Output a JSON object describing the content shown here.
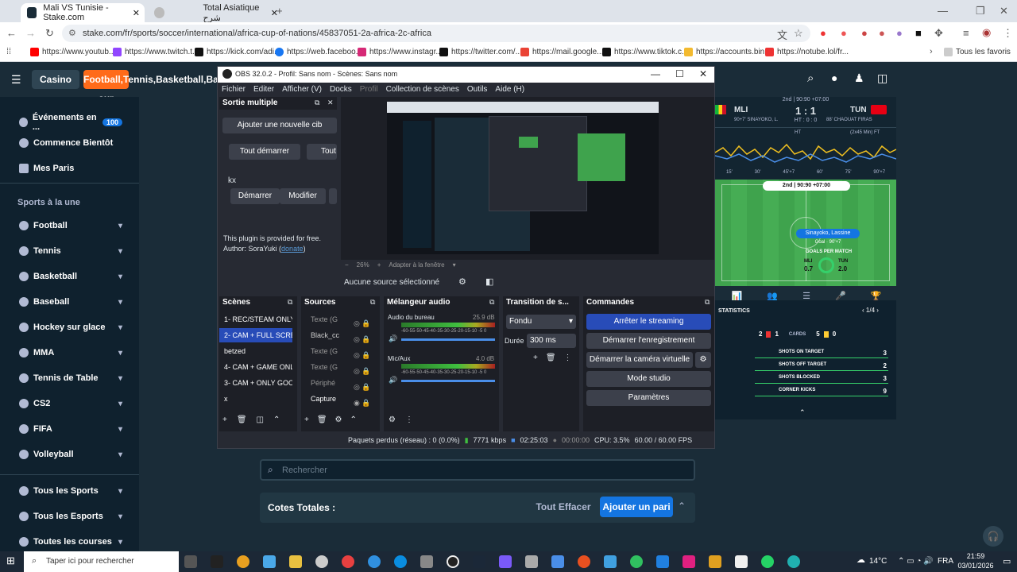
{
  "browser": {
    "tabs": [
      {
        "title": "Mali VS Tunisie - Stake.com"
      },
      {
        "title": "Total Asiatique شرح"
      }
    ],
    "url": "stake.com/fr/sports/soccer/international/africa-cup-of-nations/45837051-2a-africa-2c-africa",
    "bookmarks": [
      "https://www.youtub...",
      "https://www.twitch.t...",
      "https://kick.com/adi...",
      "https://web.faceboo...",
      "https://www.instagr...",
      "https://twitter.com/...",
      "https://mail.google...",
      "https://www.tiktok.c...",
      "https://accounts.bin...",
      "https://notube.lol/fr..."
    ],
    "all_bookmarks": "Tous les favoris"
  },
  "site": {
    "casino": "Casino",
    "sports": [
      "Football",
      "Tennis",
      "Basketball",
      "Baseball",
      "Hockey sur glace",
      "MMA",
      "Tennis de Table",
      "CS2",
      "FIFA",
      "Volleyball"
    ],
    "nav": [
      {
        "label": "Événements en ...",
        "badge": "100"
      },
      {
        "label": "Commence Bientôt"
      },
      {
        "label": "Mes Paris"
      }
    ],
    "section_title": "Sports à la une",
    "bottom": [
      "Tous les Sports",
      "Tous les Esports",
      "Toutes les courses"
    ],
    "search_placeholder": "Rechercher",
    "betslip": {
      "title": "Cotes Totales :",
      "clear": "Tout Effacer",
      "add": "Ajouter un pari"
    }
  },
  "match": {
    "period": "2nd | 90:90 +07:00",
    "team_home": "MLI",
    "team_away": "TUN",
    "score": "1 : 1",
    "ht": "HT : 0 : 0",
    "event_home": "90+7' SINAYOKO, L.",
    "event_away": "88' CHAOUAT FIRAS",
    "ft": "(2x45 Min) FT",
    "ht_marker": "HT",
    "timeline": [
      "15'",
      "30'",
      "45'+7",
      "60'",
      "75'",
      "90'+7"
    ],
    "pitch_time": "2nd | 90:90 +07:00",
    "player": "Sinayoko, Lassine",
    "goal": "Goal · 90'+7",
    "goals_per_match": "GOALS PER MATCH",
    "gpm_home": "0.7",
    "gpm_away": "2.0",
    "stats_title": "STATISTICS",
    "page": "1/4",
    "cards_home": "2",
    "cards_home2": "1",
    "cards_label": "CARDS",
    "cards_away": "5",
    "cards_away2": "0",
    "stats": [
      {
        "label": "SHOTS ON TARGET",
        "home": "",
        "away": "3"
      },
      {
        "label": "SHOTS OFF TARGET",
        "home": "",
        "away": "2"
      },
      {
        "label": "SHOTS BLOCKED",
        "home": "",
        "away": "3"
      },
      {
        "label": "CORNER KICKS",
        "home": "",
        "away": "9"
      }
    ]
  },
  "obs": {
    "title": "OBS 32.0.2 - Profil: Sans nom - Scènes: Sans nom",
    "menu": [
      "Fichier",
      "Editer",
      "Afficher (V)",
      "Docks",
      "Profil",
      "Collection de scènes",
      "Outils",
      "Aide (H)"
    ],
    "multi": {
      "title": "Sortie multiple",
      "add": "Ajouter une nouvelle cib",
      "start_all": "Tout démarrer",
      "stop_all": "Tout",
      "target": "kx",
      "start": "Démarrer",
      "edit": "Modifier",
      "plugin": "This plugin is provided for free.",
      "author": "Author: SoraYuki (",
      "donate": "donate",
      ")": ")"
    },
    "preview": {
      "zoom": "26%",
      "fit": "Adapter à la fenêtre",
      "no_source": "Aucune source sélectionné"
    },
    "scenes": {
      "title": "Scènes",
      "items": [
        "1- REC/STEAM ONLY I",
        "2- CAM + FULL SCREE",
        "betzed",
        "4- CAM + GAME ONLY",
        "3- CAM + ONLY GOOG",
        "x"
      ]
    },
    "sources": {
      "title": "Sources",
      "items": [
        "Texte (G",
        "Black_cc",
        "Texte (G",
        "Texte (G",
        "Périphé",
        "Capture"
      ]
    },
    "mixer": {
      "title": "Mélangeur audio",
      "ch1": "Audio du bureau",
      "ch1db": "25.9 dB",
      "ch2": "Mic/Aux",
      "ch2db": "4.0 dB",
      "scale": "-60-55-50-45-40-35-30-25-20-15-10 -5 0"
    },
    "transition": {
      "title": "Transition de s...",
      "type": "Fondu",
      "duration_label": "Durée",
      "duration": "300 ms"
    },
    "controls": {
      "title": "Commandes",
      "stop_stream": "Arrêter le streaming",
      "start_rec": "Démarrer l'enregistrement",
      "virtual_cam": "Démarrer la caméra virtuelle",
      "studio": "Mode studio",
      "settings": "Paramètres"
    },
    "status": {
      "dropped": "Paquets perdus (réseau) : 0 (0.0%)",
      "bitrate": "7771 kbps",
      "live_time": "02:25:03",
      "rec_time": "00:00:00",
      "cpu": "CPU: 3.5%",
      "fps": "60.00 / 60.00 FPS"
    }
  },
  "taskbar": {
    "search": "Taper ici pour rechercher",
    "temp": "14°C",
    "lang": "FRA",
    "time": "21:59",
    "date": "03/01/2026"
  }
}
